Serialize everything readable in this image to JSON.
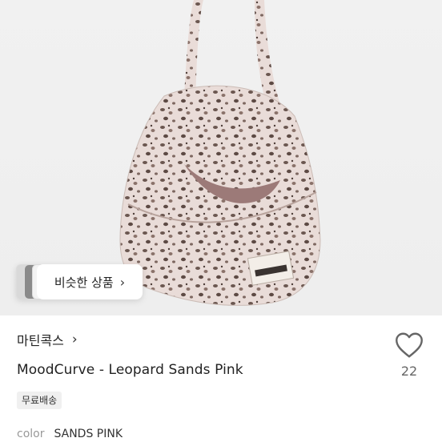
{
  "similar_button": {
    "label": "비슷한 상품",
    "chevron": "chevron-right-icon"
  },
  "shop": {
    "name": "마틴콕스",
    "chevron": "chevron-right-icon"
  },
  "product": {
    "title": "MoodCurve - Leopard Sands Pink"
  },
  "badge": {
    "label": "무료배송"
  },
  "option": {
    "label": "color",
    "value": "SANDS PINK"
  },
  "like": {
    "icon": "heart-icon",
    "count": "22"
  },
  "colors": {
    "background": "#ffffff",
    "photo_bg": "#efefef",
    "text": "#222222",
    "muted": "#999999"
  }
}
